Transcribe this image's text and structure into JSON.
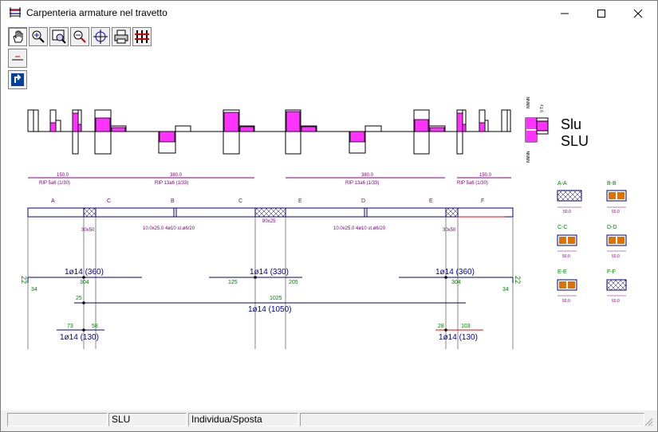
{
  "window": {
    "title": "Carpenteria armature nel travetto"
  },
  "toolbar": {
    "tools": [
      {
        "name": "pan-tool-icon"
      },
      {
        "name": "zoom-in-tool-icon"
      },
      {
        "name": "zoom-window-tool-icon"
      },
      {
        "name": "zoom-out-tool-icon"
      },
      {
        "name": "crosshair-tool-icon"
      },
      {
        "name": "print-tool-icon"
      },
      {
        "name": "settings-tool-icon"
      }
    ]
  },
  "load_case": {
    "line1": "Slu",
    "line2": "SLU"
  },
  "drawing": {
    "spans": [
      {
        "dim": "150.0",
        "rip": "RIP 5a6 (1/30)"
      },
      {
        "dim": "380.0",
        "rip": "RIP 13a6 (1/33)"
      },
      {
        "dim": "380.0",
        "rip": "RIP 13a6 (1/33)"
      },
      {
        "dim": "150.0",
        "rip": "RIP 5a6 (1/30)"
      }
    ],
    "section_marks": [
      "A",
      "C",
      "B",
      "C",
      "E",
      "D",
      "E",
      "F"
    ],
    "beam_labels": {
      "col_left": "30x50",
      "mid_section": "80x25",
      "col_right": "30x50",
      "span1_desc": "10.0x25.0  4ø10  st.ø6/20",
      "span2_desc": "10.0x25.0  4ø10  st.ø6/20"
    },
    "rebars": {
      "top_left": {
        "label": "1ø14 (360)",
        "left": "34",
        "mid": "304"
      },
      "top_mid": {
        "label": "1ø14 (330)",
        "left": "125",
        "right": "205"
      },
      "top_right": {
        "label": "1ø14 (360)",
        "mid": "304",
        "right": "34"
      },
      "bottom_long": {
        "label": "1ø14 (1050)",
        "left": "25",
        "right": "1025"
      },
      "bottom_left": {
        "label": "1ø14 (130)",
        "left": "73",
        "right": "58"
      },
      "bottom_right": {
        "label": "1ø14 (130)",
        "left": "28",
        "right": "103"
      },
      "hook_left": "22",
      "hook_right": "22"
    },
    "sections": [
      {
        "name": "A-A",
        "width": "50.0"
      },
      {
        "name": "B-B",
        "width": "50.0"
      },
      {
        "name": "C-C",
        "width": "50.0"
      },
      {
        "name": "D-D",
        "width": "50.0"
      },
      {
        "name": "E-E",
        "width": "50.0"
      },
      {
        "name": "F-F",
        "width": "50.0"
      }
    ]
  },
  "status": {
    "cell1": "",
    "cell2": "SLU",
    "cell3": "Individua/Sposta",
    "cell4": ""
  }
}
